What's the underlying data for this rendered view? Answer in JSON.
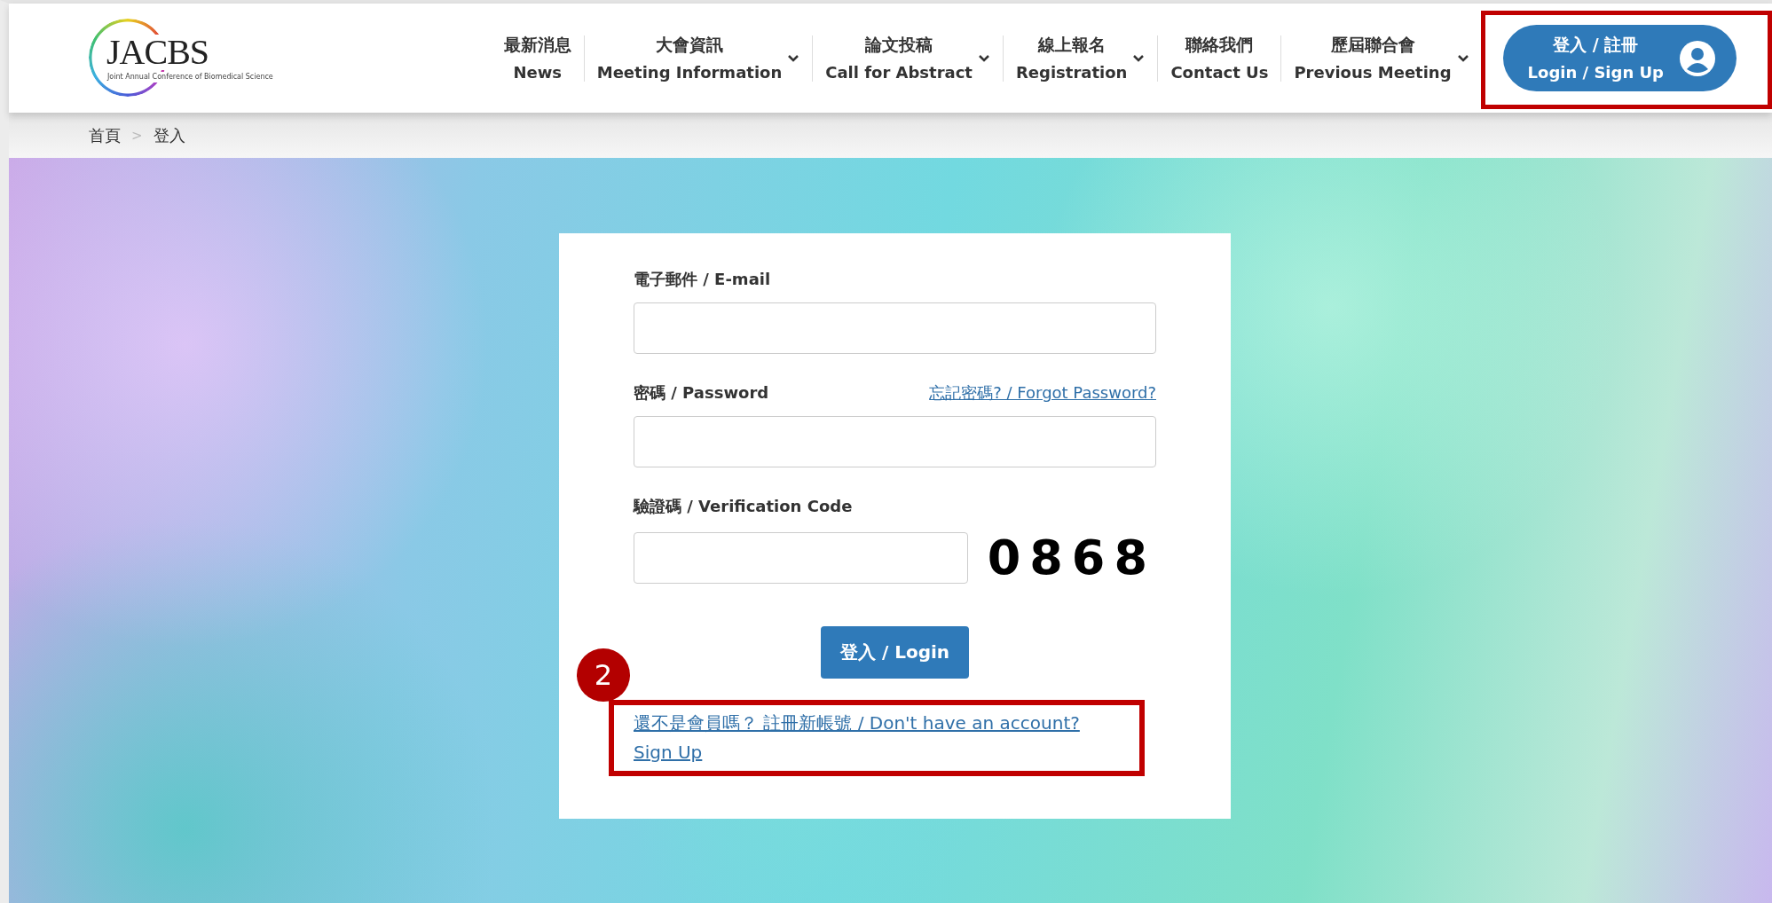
{
  "logo": {
    "title": "JACBS",
    "subtitle": "Joint Annual Conference of Biomedical Science"
  },
  "nav": [
    {
      "zh": "最新消息",
      "en": "News",
      "dropdown": false
    },
    {
      "zh": "大會資訊",
      "en": "Meeting Information",
      "dropdown": true
    },
    {
      "zh": "論文投稿",
      "en": "Call for Abstract",
      "dropdown": true
    },
    {
      "zh": "線上報名",
      "en": "Registration",
      "dropdown": true
    },
    {
      "zh": "聯絡我們",
      "en": "Contact Us",
      "dropdown": false
    },
    {
      "zh": "歷屆聯合會",
      "en": "Previous Meeting",
      "dropdown": true
    }
  ],
  "login_button": {
    "zh": "登入 / 註冊",
    "en": "Login / Sign Up",
    "highlighted": true
  },
  "breadcrumb": [
    "首頁",
    "登入"
  ],
  "breadcrumb_separator": ">",
  "form": {
    "email": {
      "label": "電子郵件 / E-mail"
    },
    "password": {
      "label": "密碼 / Password",
      "forgot_link": "忘記密碼? / Forgot Password?"
    },
    "verification": {
      "label": "驗證碼 / Verification Code",
      "code": "0868"
    },
    "submit": "登入 / Login",
    "signup_link": {
      "text": "還不是會員嗎？ 註冊新帳號 / Don't have an account? Sign Up",
      "highlighted": true
    },
    "step_badge": "2"
  }
}
